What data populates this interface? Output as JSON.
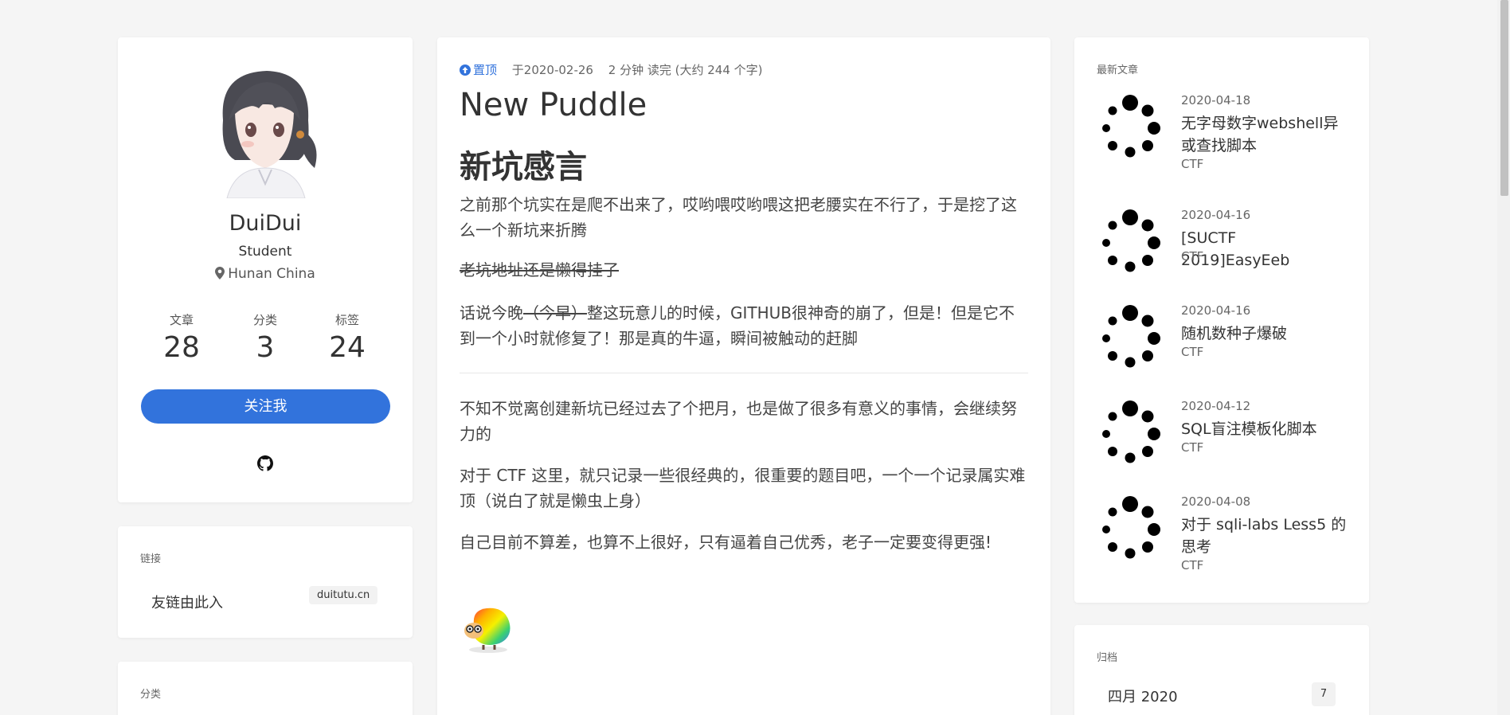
{
  "profile": {
    "name": "DuiDui",
    "role": "Student",
    "location": "Hunan China",
    "stats": [
      {
        "label": "文章",
        "value": "28"
      },
      {
        "label": "分类",
        "value": "3"
      },
      {
        "label": "标签",
        "value": "24"
      }
    ],
    "follow_label": "关注我",
    "github_icon": "github-icon"
  },
  "links": {
    "heading": "链接",
    "item_label": "友链由此入",
    "item_tag": "duitutu.cn"
  },
  "categories": {
    "heading": "分类"
  },
  "article": {
    "pin_label": "置顶",
    "date": "于2020-02-26",
    "read_time": "2 分钟 读完 (大约 244 个字)",
    "title": "New Puddle",
    "heading": "新坑感言",
    "p1": "之前那个坑实在是爬不出来了，哎哟喂哎哟喂这把老腰实在不行了，于是挖了这么一个新坑来折腾",
    "p2_strike": "老坑地址还是懒得挂了",
    "p3_a": "话说今晚",
    "p3_strike": "（今早）",
    "p3_b": "整这玩意儿的时候，GITHUB很神奇的崩了，但是！但是它不到一个小时就修复了！那是真的牛逼，瞬间被触动的赶脚",
    "p4": "不知不觉离创建新坑已经过去了个把月，也是做了很多有意义的事情，会继续努力的",
    "p5": "对于 CTF 这里，就只记录一些很经典的，很重要的题目吧，一个一个记录属实难顶（说白了就是懒虫上身）",
    "p6": "自己目前不算差，也算不上很好，只有逼着自己优秀，老子一定要变得更强!"
  },
  "recent": {
    "heading": "最新文章",
    "items": [
      {
        "date": "2020-04-18",
        "title": "无字母数字webshell异或查找脚本",
        "category": "CTF"
      },
      {
        "date": "2020-04-16",
        "title": "[SUCTF 2019]EasyEeb",
        "category": "CTF"
      },
      {
        "date": "2020-04-16",
        "title": "随机数种子爆破",
        "category": "CTF"
      },
      {
        "date": "2020-04-12",
        "title": "SQL盲注模板化脚本",
        "category": "CTF"
      },
      {
        "date": "2020-04-08",
        "title": "对于 sqli-labs Less5 的思考",
        "category": "CTF"
      }
    ]
  },
  "archive": {
    "heading": "归档",
    "month": "四月 2020",
    "count": "7"
  },
  "colors": {
    "accent": "#3273dc",
    "background": "#f5f5f5"
  }
}
